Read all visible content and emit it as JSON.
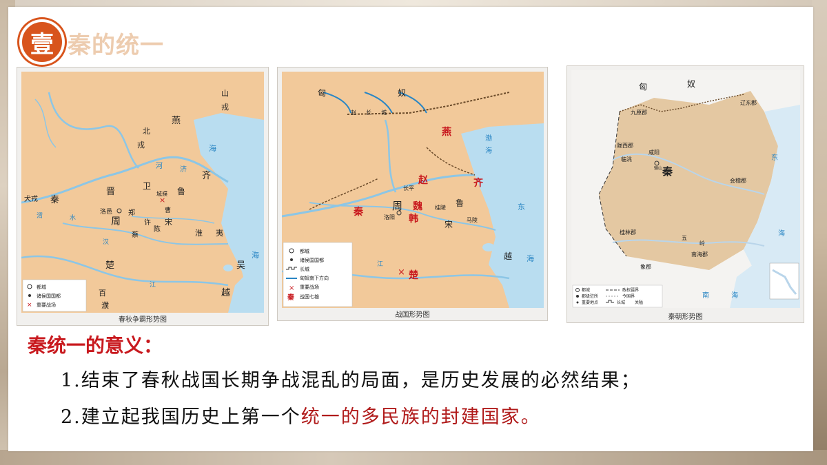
{
  "section": {
    "number": "壹",
    "title": "秦的统一"
  },
  "maps": [
    {
      "caption": "春秋争霸形势图",
      "labels": {
        "shan_rong": "山",
        "shan_rong2": "戎",
        "yan": "燕",
        "bei": "北",
        "rong": "戎",
        "sea": "海",
        "ji": "济",
        "he": "河",
        "qi": "齐",
        "wei": "卫",
        "chengpu": "城濮",
        "lu": "鲁",
        "jin": "晋",
        "quanrong": "犬戎",
        "qin": "秦",
        "luoyi": "洛邑",
        "zheng": "郑",
        "cao": "曹",
        "zhou": "周",
        "xu": "许",
        "song": "宋",
        "cai": "蔡",
        "chen": "陈",
        "huai": "淮",
        "yi": "夷",
        "wei_river": "渭",
        "shui": "水",
        "han": "汉",
        "chu": "楚",
        "wu": "吴",
        "jiang": "江",
        "baipu1": "百",
        "baipu2": "濮",
        "yue": "越",
        "sea2": "海"
      },
      "legend": [
        "都城",
        "诸侯国国都",
        "重要战场"
      ]
    },
    {
      "caption": "战国形势图",
      "labels": {
        "xiong": "匈",
        "nu": "奴",
        "zhao_wall": "赵",
        "chang": "长",
        "cheng": "城",
        "yan": "燕",
        "sea": "渤",
        "sea2": "海",
        "zhao": "赵",
        "qi": "齐",
        "changping": "长平",
        "wei": "魏",
        "guiling": "桂陵",
        "lu": "鲁",
        "zhou": "周",
        "qin": "秦",
        "han": "韩",
        "luoyang": "洛阳",
        "maling": "马陵",
        "song": "宋",
        "dong": "东",
        "jiang": "江",
        "chu": "楚",
        "yue": "越",
        "sea3": "海"
      },
      "legend": [
        "都城",
        "诸侯国国都",
        "长城",
        "匈奴南下方向",
        "重要战场",
        "战国七雄"
      ],
      "legend_qin": "秦"
    },
    {
      "caption": "秦朝形势图",
      "labels": {
        "xiong": "匈",
        "nu": "奴",
        "liaodong": "辽东郡",
        "jiuyuan": "九原郡",
        "longxi": "陇西郡",
        "xianyang": "咸阳",
        "lintao": "临洮",
        "lishan": "骊山",
        "qin": "秦",
        "kuaiji": "会稽郡",
        "dong": "东",
        "guilin": "桂林郡",
        "wu": "五",
        "ling": "岭",
        "nanhai": "南海郡",
        "xiang": "象郡",
        "sea": "海",
        "nan": "南",
        "sea2": "海"
      },
      "legend": [
        "都城",
        "郡级驻所",
        "重要地点",
        "政权疆界",
        "今国界",
        "长城",
        "关隘"
      ]
    }
  ],
  "significance": {
    "heading": "秦统一的意义：",
    "point1": "1.结束了春秋战国长期争战混乱的局面，是历史发展的必然结果；",
    "point2_prefix": "2.建立起我国历史上第一个",
    "point2_highlight": "统一的多民族的封建国家。"
  },
  "colors": {
    "accent": "#d8541c",
    "red": "#c8191e",
    "land": "#f2c99a",
    "sea": "#b9ddf0"
  }
}
